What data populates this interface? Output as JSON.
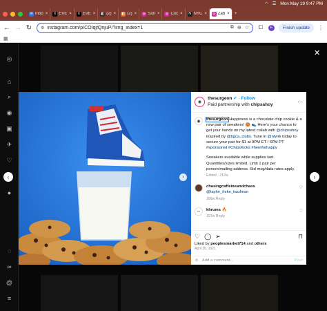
{
  "menubar": {
    "datetime": "Mon May 19  9:47 PM"
  },
  "tabs": [
    {
      "label": "Inbo",
      "color": "#2a73e8",
      "glyph": "✉"
    },
    {
      "label": "EVE",
      "color": "#000000",
      "glyph": "X"
    },
    {
      "label": "EVE",
      "color": "#000000",
      "glyph": "X"
    },
    {
      "label": "(2)",
      "color": "#333333",
      "glyph": "◧"
    },
    {
      "label": "(2)",
      "color": "#e66a1f",
      "glyph": "◧"
    },
    {
      "label": "San",
      "color": "#d6249f",
      "glyph": "◎"
    },
    {
      "label": "Coc",
      "color": "#d6249f",
      "glyph": "◎"
    },
    {
      "label": "NYC",
      "color": "#1a1a1a",
      "glyph": "N"
    },
    {
      "label": "Zab",
      "color": "#d6249f",
      "glyph": "◎",
      "active": true
    }
  ],
  "address": {
    "url": "instagram.com/p/COIqjfQnjuP/?img_index=1",
    "profile_initial": "E",
    "finish_update": "Finish update"
  },
  "post": {
    "username": "thesurgeon",
    "follow": "Follow",
    "partner_prefix": "Paid partnership with",
    "partner": "chipsahoy",
    "caption_user": "thesurgeon",
    "caption_p1": " Happiness is a chocolate chip cookie & a new pair of sneakers! 🍪 👟 Here's your chance to get your hands on my latest collab with ",
    "caption_mention1": "@chipsahoy",
    "caption_p2": " inspired by ",
    "caption_mention2": "@bgca_clubs",
    "caption_p3": ". Tune in ",
    "caption_mention3": "@ntwrk",
    "caption_p4": " today to secure your pair for $1 at 9PM ET / 6PM PT ",
    "caption_tags": "#sponsored #ChipsKicks #hereforhappy",
    "caption_p5": "Sneakers available while supplies last. Quantities/sizes limited. Limit 1 pair per person/mailing address. Std msg/data rates apply.",
    "edited": "Edited · 212w",
    "comments": [
      {
        "user": "chasingcaffeineandchaos",
        "mention": "@taylor_ihrke_kaufman",
        "meta": "186w   Reply"
      },
      {
        "user": "khrums",
        "emoji": "🔥",
        "meta": "197w   Reply"
      }
    ],
    "likes_prefix": "Liked by ",
    "likes_user": "peoplesmarket714",
    "likes_suffix": " and ",
    "likes_others": "others",
    "date": "April 26, 2021",
    "add_comment": "Add a comment...",
    "post_btn": "Post"
  }
}
